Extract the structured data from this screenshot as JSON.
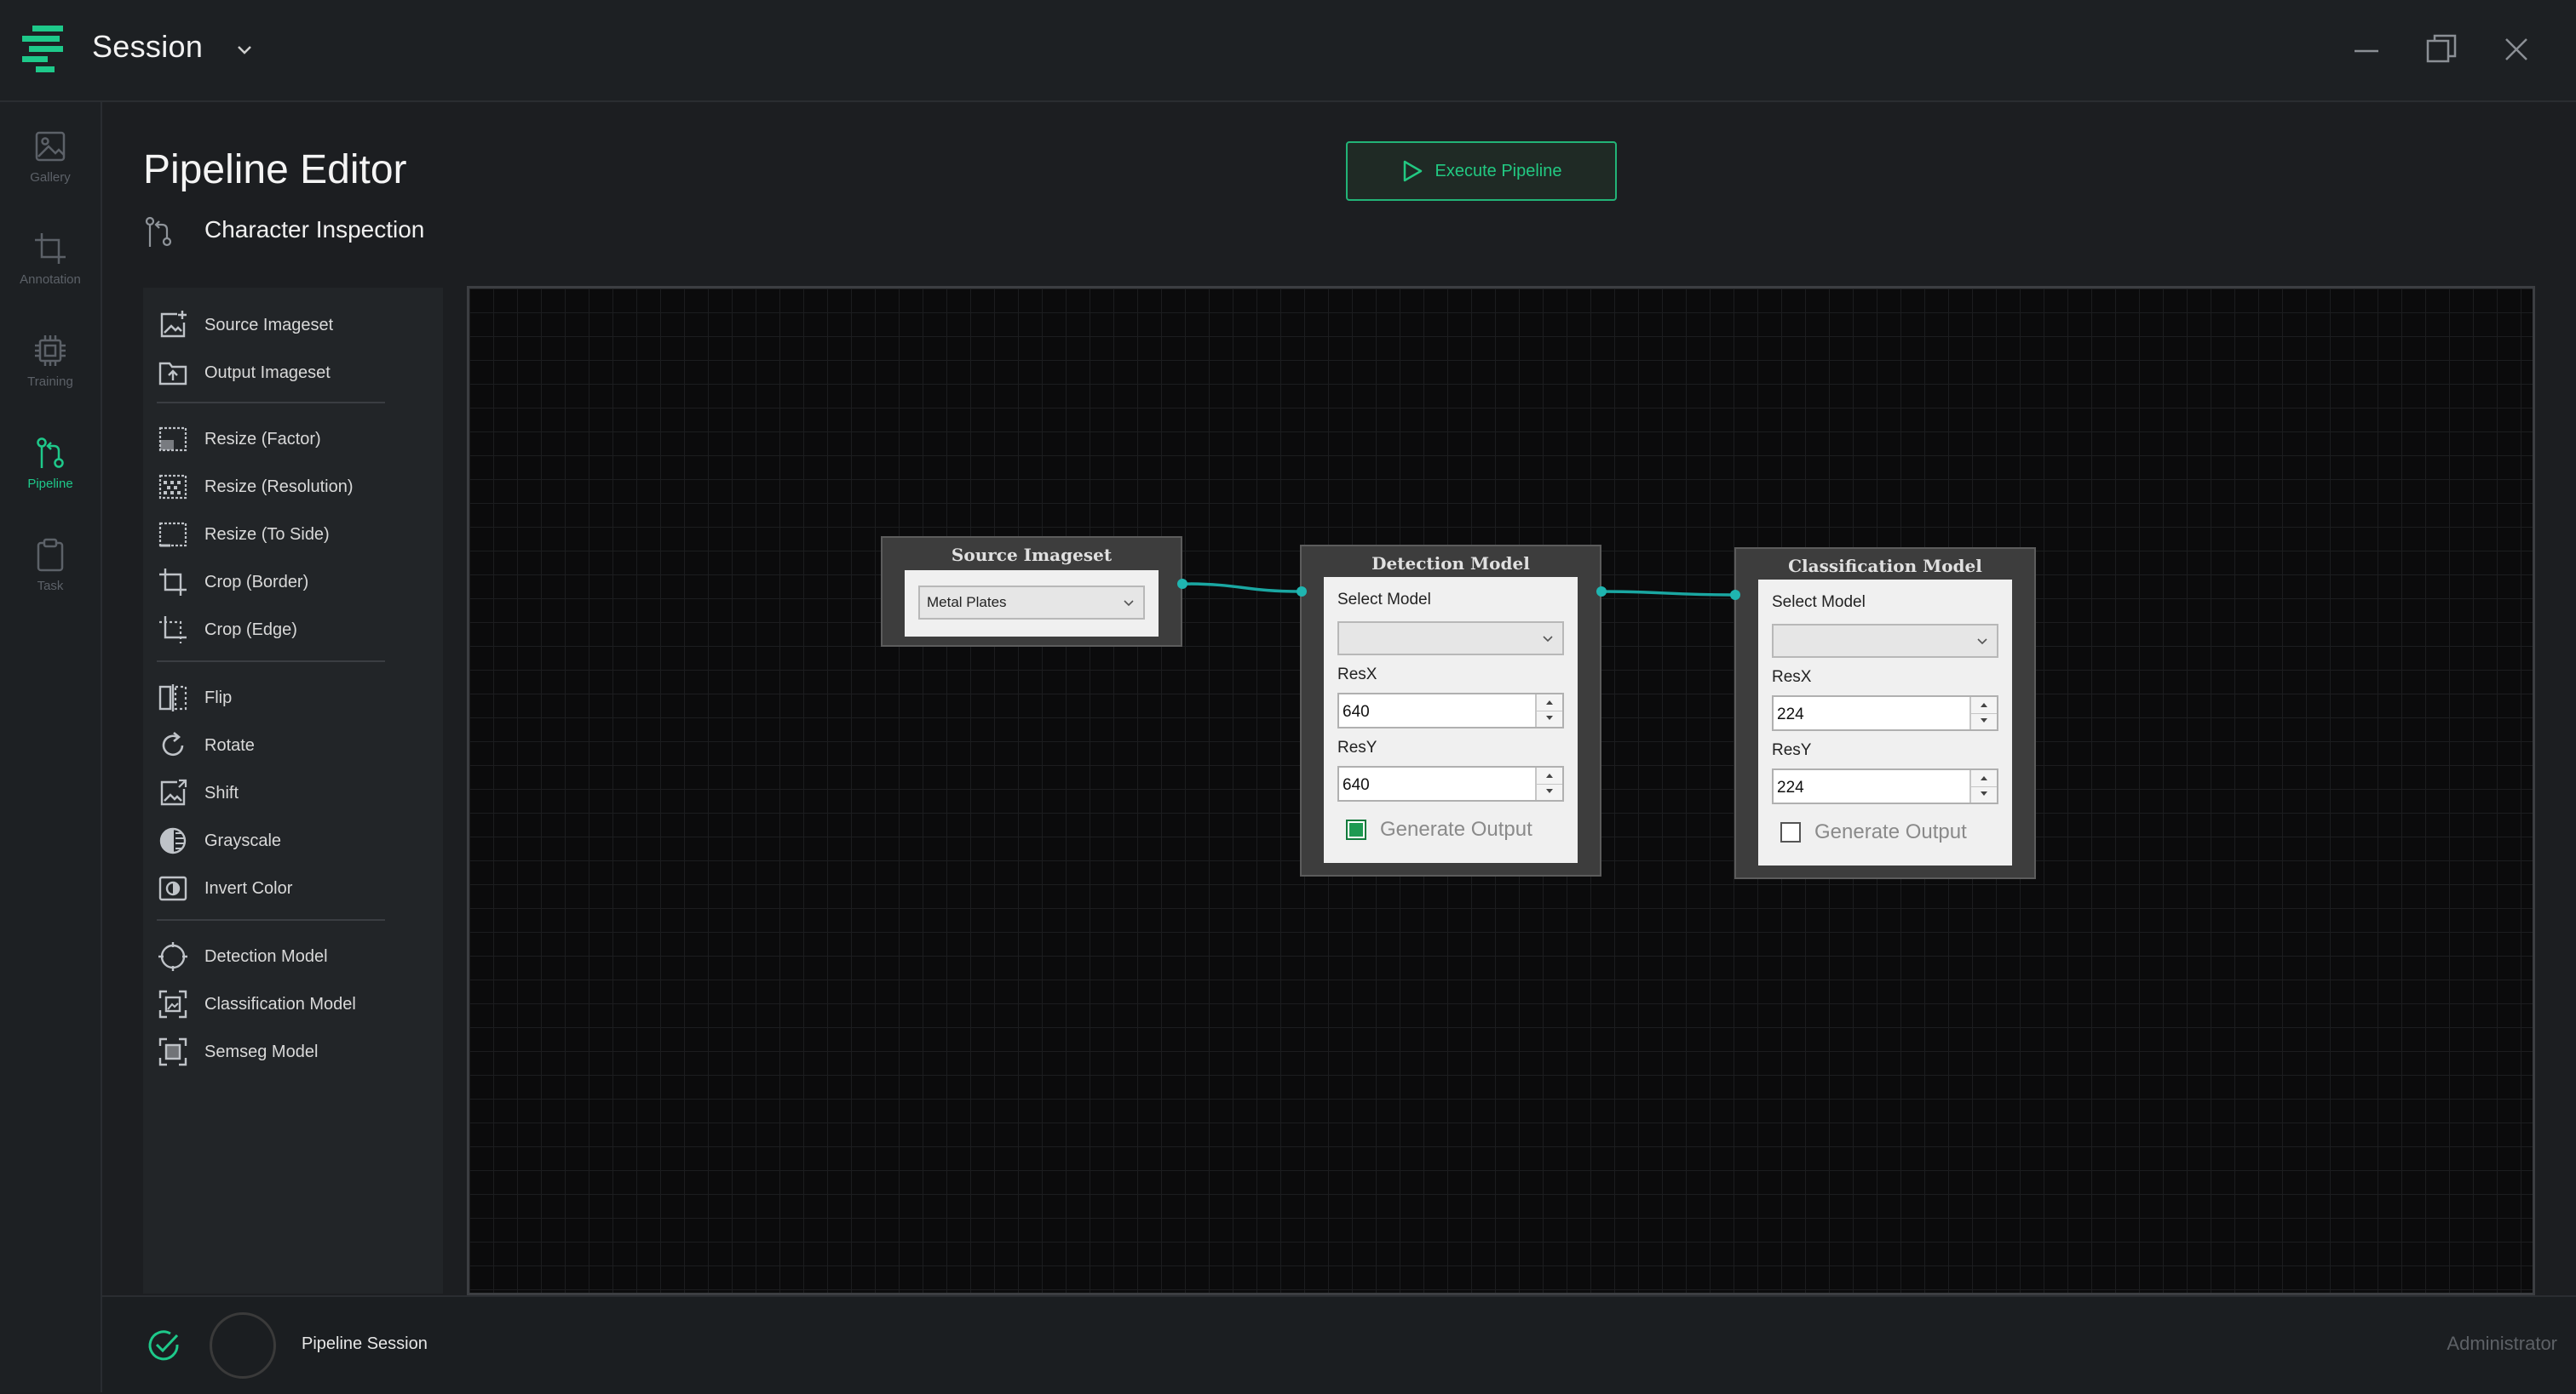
{
  "titlebar": {
    "title": "Session",
    "accent": "#1ec98a"
  },
  "nav": {
    "items": [
      {
        "label": "Gallery",
        "icon": "image-icon",
        "active": false
      },
      {
        "label": "Annotation",
        "icon": "crop-icon",
        "active": false
      },
      {
        "label": "Training",
        "icon": "chip-icon",
        "active": false
      },
      {
        "label": "Pipeline",
        "icon": "pipeline-icon",
        "active": true
      },
      {
        "label": "Task",
        "icon": "clipboard-icon",
        "active": false
      }
    ]
  },
  "header": {
    "title": "Pipeline Editor",
    "pipeline_name": "Character Inspection",
    "execute_label": "Execute Pipeline"
  },
  "palette": {
    "items": [
      {
        "label": "Source Imageset",
        "icon": "image-add-icon"
      },
      {
        "label": "Output Imageset",
        "icon": "folder-output-icon"
      },
      {
        "label": "Resize (Factor)",
        "icon": "resize-factor-icon"
      },
      {
        "label": "Resize (Resolution)",
        "icon": "resize-resolution-icon"
      },
      {
        "label": "Resize (To Side)",
        "icon": "resize-side-icon"
      },
      {
        "label": "Crop (Border)",
        "icon": "crop-border-icon"
      },
      {
        "label": "Crop (Edge)",
        "icon": "crop-edge-icon"
      },
      {
        "label": "Flip",
        "icon": "flip-icon"
      },
      {
        "label": "Rotate",
        "icon": "rotate-icon"
      },
      {
        "label": "Shift",
        "icon": "shift-icon"
      },
      {
        "label": "Grayscale",
        "icon": "grayscale-icon"
      },
      {
        "label": "Invert Color",
        "icon": "invert-color-icon"
      },
      {
        "label": "Detection Model",
        "icon": "detection-icon"
      },
      {
        "label": "Classification Model",
        "icon": "classification-icon"
      },
      {
        "label": "Semseg Model",
        "icon": "semseg-icon"
      }
    ]
  },
  "nodes": {
    "source": {
      "title": "Source Imageset",
      "selected": "Metal Plates"
    },
    "detection": {
      "title": "Detection Model",
      "select_label": "Select Model",
      "selected": "",
      "resx_label": "ResX",
      "resx": "640",
      "resy_label": "ResY",
      "resy": "640",
      "gen_label": "Generate Output",
      "generate_output": true
    },
    "classification": {
      "title": "Classification Model",
      "select_label": "Select Model",
      "selected": "",
      "resx_label": "ResX",
      "resx": "224",
      "resy_label": "ResY",
      "resy": "224",
      "gen_label": "Generate Output",
      "generate_output": false
    }
  },
  "status": {
    "text": "Pipeline Session",
    "user": "Administrator"
  }
}
